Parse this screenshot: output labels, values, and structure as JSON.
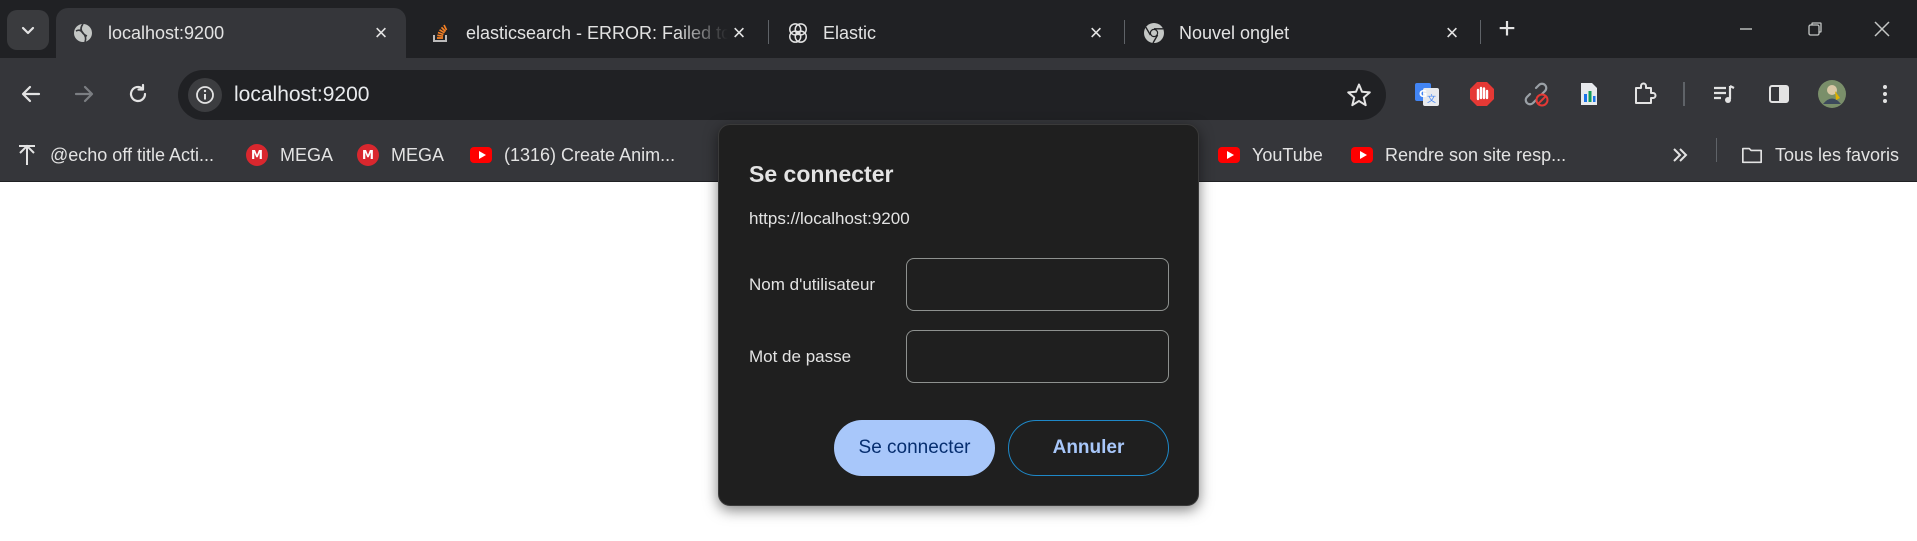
{
  "tabs": [
    {
      "title": "localhost:9200",
      "favicon": "globe-icon",
      "active": true
    },
    {
      "title": "elasticsearch - ERROR: Failed to",
      "favicon": "stackoverflow-icon",
      "active": false
    },
    {
      "title": "Elastic",
      "favicon": "elastic-icon",
      "active": false
    },
    {
      "title": "Nouvel onglet",
      "favicon": "chrome-icon",
      "active": false
    }
  ],
  "omnibox": {
    "url": "localhost:9200"
  },
  "bookmarks": [
    {
      "label": "@echo off title Acti...",
      "icon": "arrow-up-icon"
    },
    {
      "label": "MEGA",
      "icon": "mega-icon"
    },
    {
      "label": "MEGA",
      "icon": "mega-icon"
    },
    {
      "label": "(1316) Create Anim...",
      "icon": "youtube-icon"
    },
    {
      "label": "YouTube",
      "icon": "youtube-icon"
    },
    {
      "label": "Rendre son site resp...",
      "icon": "youtube-icon"
    }
  ],
  "all_bookmarks_label": "Tous les favoris",
  "dialog": {
    "title": "Se connecter",
    "origin": "https://localhost:9200",
    "username_label": "Nom d'utilisateur",
    "username_value": "",
    "password_label": "Mot de passe",
    "password_value": "",
    "submit_label": "Se connecter",
    "cancel_label": "Annuler"
  },
  "colors": {
    "tabstrip_bg": "#202124",
    "toolbar_bg": "#35363a",
    "dialog_bg": "#1f1f1f",
    "primary_button": "#a8c7fa",
    "page_bg": "#ffffff"
  }
}
